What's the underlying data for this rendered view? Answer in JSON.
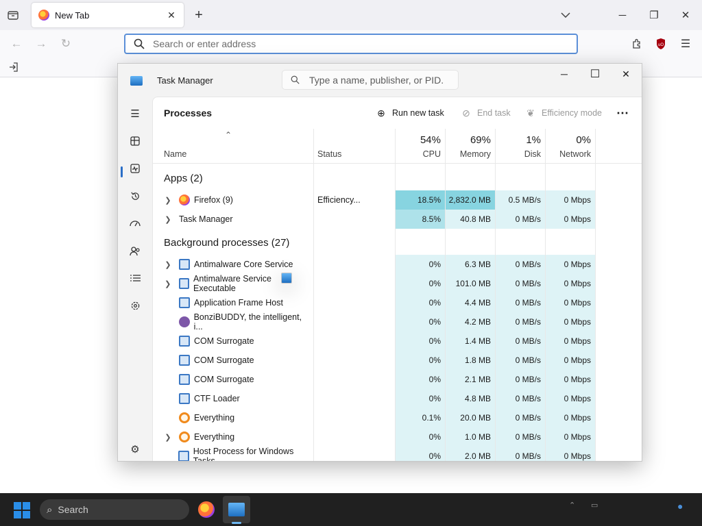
{
  "browser": {
    "tab_title": "New Tab",
    "url_placeholder": "Search or enter address",
    "icons": {
      "tab_list": "folder-icon",
      "close_tab": "close-icon",
      "new_tab": "plus-icon",
      "list_all_tabs": "chevron-down-icon",
      "back": "back-arrow-icon",
      "forward": "forward-arrow-icon",
      "reload": "reload-icon",
      "search": "search-icon",
      "extensions": "puzzle-icon",
      "ublock": "shield-icon",
      "menu": "hamburger-icon",
      "sign_in": "sign-in-icon"
    },
    "window_controls": {
      "minimize": "─",
      "maximize": "❐",
      "close": "✕"
    }
  },
  "task_manager": {
    "title": "Task Manager",
    "search_placeholder": "Type a name, publisher, or PID...",
    "page_title": "Processes",
    "commands": {
      "run_new_task": "Run new task",
      "end_task": "End task",
      "efficiency_mode": "Efficiency mode",
      "more": "⋯"
    },
    "window_controls": {
      "minimize": "─",
      "maximize": "☐",
      "close": "✕"
    },
    "rail": [
      "hamburger-icon",
      "processes-icon",
      "performance-icon",
      "app-history-icon",
      "startup-apps-icon",
      "users-icon",
      "details-icon",
      "services-icon",
      "settings-icon"
    ],
    "columns": {
      "name": "Name",
      "status": "Status",
      "cpu": {
        "pct": "54%",
        "label": "CPU"
      },
      "memory": {
        "pct": "69%",
        "label": "Memory"
      },
      "disk": {
        "pct": "1%",
        "label": "Disk"
      },
      "network": {
        "pct": "0%",
        "label": "Network"
      }
    },
    "groups": {
      "apps": "Apps (2)",
      "background": "Background processes (27)"
    },
    "apps": [
      {
        "name": "Firefox (9)",
        "status": "Efficiency...",
        "cpu": "18.5%",
        "memory": "2,832.0 MB",
        "disk": "0.5 MB/s",
        "network": "0 Mbps",
        "icon": "firefox-icon"
      },
      {
        "name": "Task Manager",
        "status": "",
        "cpu": "8.5%",
        "memory": "40.8 MB",
        "disk": "0 MB/s",
        "network": "0 Mbps",
        "icon": "task-manager-icon"
      }
    ],
    "background": [
      {
        "name": "Antimalware Core Service",
        "cpu": "0%",
        "memory": "6.3 MB",
        "disk": "0 MB/s",
        "network": "0 Mbps",
        "icon": "service-icon"
      },
      {
        "name": "Antimalware Service Executable",
        "cpu": "0%",
        "memory": "101.0 MB",
        "disk": "0 MB/s",
        "network": "0 Mbps",
        "icon": "service-icon"
      },
      {
        "name": "Application Frame Host",
        "cpu": "0%",
        "memory": "4.4 MB",
        "disk": "0 MB/s",
        "network": "0 Mbps",
        "icon": "service-icon"
      },
      {
        "name": "BonziBUDDY, the intelligent, i...",
        "cpu": "0%",
        "memory": "4.2 MB",
        "disk": "0 MB/s",
        "network": "0 Mbps",
        "icon": "bonzi-icon"
      },
      {
        "name": "COM Surrogate",
        "cpu": "0%",
        "memory": "1.4 MB",
        "disk": "0 MB/s",
        "network": "0 Mbps",
        "icon": "service-icon"
      },
      {
        "name": "COM Surrogate",
        "cpu": "0%",
        "memory": "1.8 MB",
        "disk": "0 MB/s",
        "network": "0 Mbps",
        "icon": "service-icon"
      },
      {
        "name": "COM Surrogate",
        "cpu": "0%",
        "memory": "2.1 MB",
        "disk": "0 MB/s",
        "network": "0 Mbps",
        "icon": "service-icon"
      },
      {
        "name": "CTF Loader",
        "cpu": "0%",
        "memory": "4.8 MB",
        "disk": "0 MB/s",
        "network": "0 Mbps",
        "icon": "service-icon"
      },
      {
        "name": "Everything",
        "cpu": "0.1%",
        "memory": "20.0 MB",
        "disk": "0 MB/s",
        "network": "0 Mbps",
        "icon": "everything-icon"
      },
      {
        "name": "Everything",
        "cpu": "0%",
        "memory": "1.0 MB",
        "disk": "0 MB/s",
        "network": "0 Mbps",
        "icon": "everything-icon"
      },
      {
        "name": "Host Process for Windows Tasks",
        "cpu": "0%",
        "memory": "2.0 MB",
        "disk": "0 MB/s",
        "network": "0 Mbps",
        "icon": "service-icon"
      }
    ]
  },
  "taskbar": {
    "search_label": "Search",
    "apps": [
      "firefox-icon",
      "task-manager-icon"
    ]
  }
}
